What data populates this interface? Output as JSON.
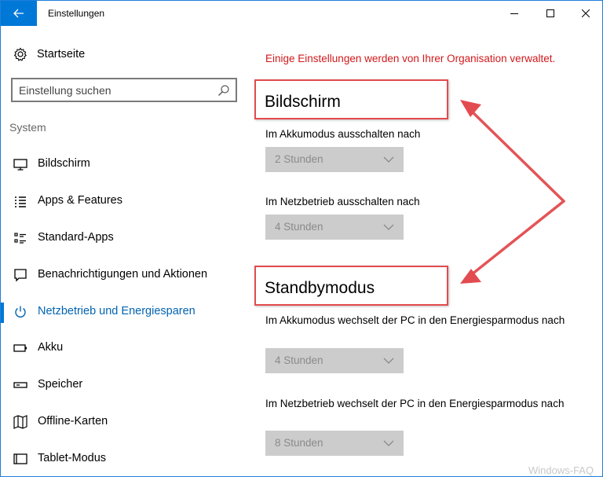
{
  "window": {
    "title": "Einstellungen"
  },
  "sidebar": {
    "home_label": "Startseite",
    "search_placeholder": "Einstellung suchen",
    "section_label": "System",
    "items": [
      {
        "label": "Bildschirm",
        "icon": "monitor-icon"
      },
      {
        "label": "Apps & Features",
        "icon": "apps-list-icon"
      },
      {
        "label": "Standard-Apps",
        "icon": "default-apps-icon"
      },
      {
        "label": "Benachrichtigungen und Aktionen",
        "icon": "notification-icon"
      },
      {
        "label": "Netzbetrieb und Energiesparen",
        "icon": "power-icon",
        "active": true
      },
      {
        "label": "Akku",
        "icon": "battery-icon"
      },
      {
        "label": "Speicher",
        "icon": "storage-icon"
      },
      {
        "label": "Offline-Karten",
        "icon": "map-icon"
      },
      {
        "label": "Tablet-Modus",
        "icon": "tablet-icon"
      }
    ]
  },
  "main": {
    "org_note": "Einige Einstellungen werden von Ihrer Organisation verwaltet.",
    "screen": {
      "heading": "Bildschirm",
      "battery_label": "Im Akkumodus ausschalten nach",
      "battery_value": "2 Stunden",
      "ac_label": "Im Netzbetrieb ausschalten nach",
      "ac_value": "4 Stunden"
    },
    "standby": {
      "heading": "Standbymodus",
      "battery_label": "Im Akkumodus wechselt der PC in den Energiesparmodus nach",
      "battery_value": "4 Stunden",
      "ac_label": "Im Netzbetrieb wechselt der PC in den Energiesparmodus nach",
      "ac_value": "8 Stunden"
    }
  },
  "watermark": "Windows-FAQ",
  "colors": {
    "accent": "#0078d7",
    "warning_text": "#d1191b",
    "annotation": "#e24b4f",
    "dropdown_bg": "#cccccc"
  }
}
